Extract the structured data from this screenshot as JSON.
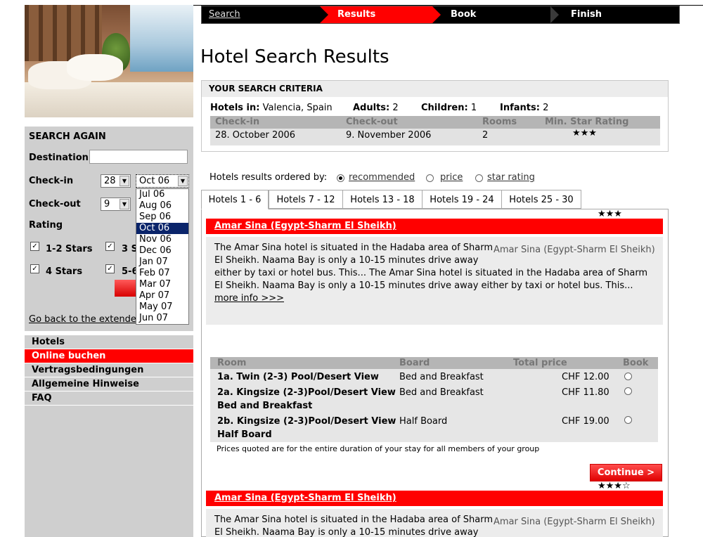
{
  "steps": {
    "search": "Search",
    "results": "Results",
    "book": "Book",
    "finish": "Finish"
  },
  "page_title": "Hotel Search Results",
  "search_again": {
    "title": "SEARCH AGAIN",
    "destination_label": "Destination",
    "destination_value": "",
    "checkin_label": "Check-in",
    "checkin_day": "28",
    "checkin_month": "Oct 06",
    "checkout_label": "Check-out",
    "checkout_day": "9",
    "rating_label": "Rating",
    "rating_options": [
      "1-2 Stars",
      "3 S",
      "4 Stars",
      "5-6"
    ],
    "back_link": "Go back to the extended",
    "month_dropdown": [
      "Jul 06",
      "Aug 06",
      "Sep 06",
      "Oct 06",
      "Nov 06",
      "Dec 06",
      "Jan 07",
      "Feb 07",
      "Mar 07",
      "Apr 07",
      "May 07",
      "Jun 07"
    ],
    "month_selected": "Oct 06"
  },
  "menu": [
    "Hotels",
    "Online buchen",
    "Vertragsbedingungen",
    "Allgemeine Hinweise",
    "FAQ"
  ],
  "menu_active": "Online buchen",
  "criteria": {
    "title": "YOUR SEARCH CRITERIA",
    "hotels_in_label": "Hotels in:",
    "hotels_in_value": "Valencia, Spain",
    "adults_label": "Adults:",
    "adults_value": "2",
    "children_label": "Children:",
    "children_value": "1",
    "infants_label": "Infants:",
    "infants_value": "2",
    "headers": [
      "Check-in",
      "Check-out",
      "Rooms",
      "Min. Star Rating"
    ],
    "checkin": "28. October 2006",
    "checkout": "9. November 2006",
    "rooms": "2",
    "min_stars": "★★★"
  },
  "ordering": {
    "label": "Hotels results ordered by:",
    "options": [
      "recommended",
      "price",
      "star rating"
    ],
    "selected": "recommended"
  },
  "tabs": [
    "Hotels 1 - 6",
    "Hotels 7 - 12",
    "Hotels 13 - 18",
    "Hotels 19 - 24",
    "Hotels 25 - 30"
  ],
  "tab_active": "Hotels 1 - 6",
  "hotels": [
    {
      "stars": "★★★",
      "name": "Amar Sina (Egypt-Sharm El Sheikh)",
      "desc_line1": "The Amar Sina hotel is situated in the Hadaba area of Sharm",
      "desc_line2": "El Sheikh. Naama Bay is only a 10-15 minutes drive away",
      "desc_rest": "either by taxi or hotel bus. This... The Amar Sina hotel is situated in the Hadaba area of Sharm El Sheikh. Naama Bay is only a 10-15 minutes drive away either by taxi or hotel bus. This...",
      "image_caption": "Amar Sina (Egypt-Sharm El Sheikh)",
      "more_info": "more info >>>",
      "room_headers": [
        "Room",
        "Board",
        "Total price",
        "Book"
      ],
      "rooms": [
        {
          "room": "1a. Twin (2-3) Pool/Desert View",
          "board": "Bed and Breakfast",
          "price": "CHF 12.00"
        },
        {
          "room": "2a. Kingsize (2-3)Pool/Desert View Bed and Breakfast",
          "board": "Bed and Breakfast",
          "price": "CHF 11.80"
        },
        {
          "room": "2b. Kingsize (2-3)Pool/Desert View Half Board",
          "board": "Half Board",
          "price": "CHF 19.00"
        }
      ],
      "price_note": "Prices quoted are for the entire duration of your stay for all members of your group",
      "continue_label": "Continue >"
    },
    {
      "stars": "★★★☆",
      "name": "Amar Sina (Egypt-Sharm El Sheikh)",
      "desc_line1": "The Amar Sina hotel is situated in the Hadaba area of Sharm",
      "desc_line2": "El Sheikh. Naama Bay is only a 10-15 minutes drive away",
      "image_caption": "Amar Sina (Egypt-Sharm El Sheikh)"
    }
  ]
}
